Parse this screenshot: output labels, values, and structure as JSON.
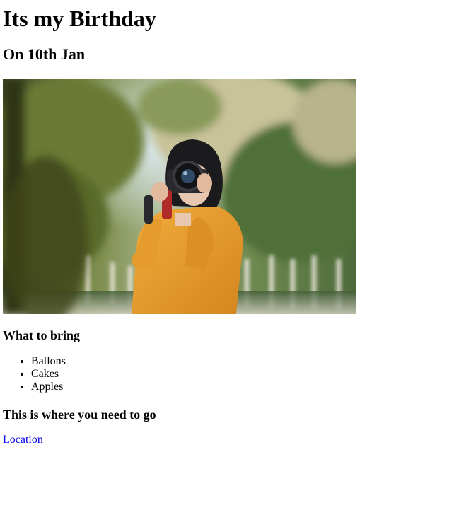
{
  "header": {
    "title": "Its my Birthday",
    "subtitle": "On 10th Jan"
  },
  "photo": {
    "description_icon": "photo-woman-with-camera"
  },
  "bring": {
    "heading": "What to bring",
    "items": [
      "Ballons",
      "Cakes",
      "Apples"
    ]
  },
  "directions": {
    "heading": "This is where you need to go",
    "link_label": "Location"
  },
  "colors": {
    "link": "#0000ee",
    "sweater": "#e39a2d"
  }
}
